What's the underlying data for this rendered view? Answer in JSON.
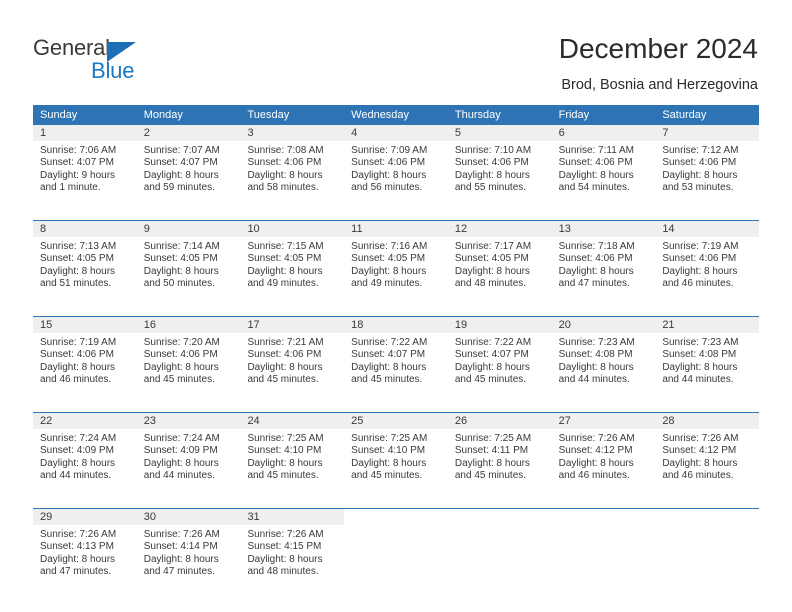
{
  "brand": {
    "word_one": "General",
    "word_two": "Blue",
    "triangle_icon": "triangle-icon",
    "accent_color": "#1a7ac4"
  },
  "header": {
    "title": "December 2024",
    "subtitle": "Brod, Bosnia and Herzegovina"
  },
  "calendar": {
    "header_color": "#2e74b5",
    "date_band_color": "#efefef",
    "weekday_labels": [
      "Sunday",
      "Monday",
      "Tuesday",
      "Wednesday",
      "Thursday",
      "Friday",
      "Saturday"
    ],
    "labels": {
      "sunrise": "Sunrise:",
      "sunset": "Sunset:",
      "daylight": "Daylight:"
    },
    "weeks": [
      [
        {
          "day": "1",
          "sunrise": "Sunrise: 7:06 AM",
          "sunset": "Sunset: 4:07 PM",
          "daylight_1": "Daylight: 9 hours",
          "daylight_2": "and 1 minute."
        },
        {
          "day": "2",
          "sunrise": "Sunrise: 7:07 AM",
          "sunset": "Sunset: 4:07 PM",
          "daylight_1": "Daylight: 8 hours",
          "daylight_2": "and 59 minutes."
        },
        {
          "day": "3",
          "sunrise": "Sunrise: 7:08 AM",
          "sunset": "Sunset: 4:06 PM",
          "daylight_1": "Daylight: 8 hours",
          "daylight_2": "and 58 minutes."
        },
        {
          "day": "4",
          "sunrise": "Sunrise: 7:09 AM",
          "sunset": "Sunset: 4:06 PM",
          "daylight_1": "Daylight: 8 hours",
          "daylight_2": "and 56 minutes."
        },
        {
          "day": "5",
          "sunrise": "Sunrise: 7:10 AM",
          "sunset": "Sunset: 4:06 PM",
          "daylight_1": "Daylight: 8 hours",
          "daylight_2": "and 55 minutes."
        },
        {
          "day": "6",
          "sunrise": "Sunrise: 7:11 AM",
          "sunset": "Sunset: 4:06 PM",
          "daylight_1": "Daylight: 8 hours",
          "daylight_2": "and 54 minutes."
        },
        {
          "day": "7",
          "sunrise": "Sunrise: 7:12 AM",
          "sunset": "Sunset: 4:06 PM",
          "daylight_1": "Daylight: 8 hours",
          "daylight_2": "and 53 minutes."
        }
      ],
      [
        {
          "day": "8",
          "sunrise": "Sunrise: 7:13 AM",
          "sunset": "Sunset: 4:05 PM",
          "daylight_1": "Daylight: 8 hours",
          "daylight_2": "and 51 minutes."
        },
        {
          "day": "9",
          "sunrise": "Sunrise: 7:14 AM",
          "sunset": "Sunset: 4:05 PM",
          "daylight_1": "Daylight: 8 hours",
          "daylight_2": "and 50 minutes."
        },
        {
          "day": "10",
          "sunrise": "Sunrise: 7:15 AM",
          "sunset": "Sunset: 4:05 PM",
          "daylight_1": "Daylight: 8 hours",
          "daylight_2": "and 49 minutes."
        },
        {
          "day": "11",
          "sunrise": "Sunrise: 7:16 AM",
          "sunset": "Sunset: 4:05 PM",
          "daylight_1": "Daylight: 8 hours",
          "daylight_2": "and 49 minutes."
        },
        {
          "day": "12",
          "sunrise": "Sunrise: 7:17 AM",
          "sunset": "Sunset: 4:05 PM",
          "daylight_1": "Daylight: 8 hours",
          "daylight_2": "and 48 minutes."
        },
        {
          "day": "13",
          "sunrise": "Sunrise: 7:18 AM",
          "sunset": "Sunset: 4:06 PM",
          "daylight_1": "Daylight: 8 hours",
          "daylight_2": "and 47 minutes."
        },
        {
          "day": "14",
          "sunrise": "Sunrise: 7:19 AM",
          "sunset": "Sunset: 4:06 PM",
          "daylight_1": "Daylight: 8 hours",
          "daylight_2": "and 46 minutes."
        }
      ],
      [
        {
          "day": "15",
          "sunrise": "Sunrise: 7:19 AM",
          "sunset": "Sunset: 4:06 PM",
          "daylight_1": "Daylight: 8 hours",
          "daylight_2": "and 46 minutes."
        },
        {
          "day": "16",
          "sunrise": "Sunrise: 7:20 AM",
          "sunset": "Sunset: 4:06 PM",
          "daylight_1": "Daylight: 8 hours",
          "daylight_2": "and 45 minutes."
        },
        {
          "day": "17",
          "sunrise": "Sunrise: 7:21 AM",
          "sunset": "Sunset: 4:06 PM",
          "daylight_1": "Daylight: 8 hours",
          "daylight_2": "and 45 minutes."
        },
        {
          "day": "18",
          "sunrise": "Sunrise: 7:22 AM",
          "sunset": "Sunset: 4:07 PM",
          "daylight_1": "Daylight: 8 hours",
          "daylight_2": "and 45 minutes."
        },
        {
          "day": "19",
          "sunrise": "Sunrise: 7:22 AM",
          "sunset": "Sunset: 4:07 PM",
          "daylight_1": "Daylight: 8 hours",
          "daylight_2": "and 45 minutes."
        },
        {
          "day": "20",
          "sunrise": "Sunrise: 7:23 AM",
          "sunset": "Sunset: 4:08 PM",
          "daylight_1": "Daylight: 8 hours",
          "daylight_2": "and 44 minutes."
        },
        {
          "day": "21",
          "sunrise": "Sunrise: 7:23 AM",
          "sunset": "Sunset: 4:08 PM",
          "daylight_1": "Daylight: 8 hours",
          "daylight_2": "and 44 minutes."
        }
      ],
      [
        {
          "day": "22",
          "sunrise": "Sunrise: 7:24 AM",
          "sunset": "Sunset: 4:09 PM",
          "daylight_1": "Daylight: 8 hours",
          "daylight_2": "and 44 minutes."
        },
        {
          "day": "23",
          "sunrise": "Sunrise: 7:24 AM",
          "sunset": "Sunset: 4:09 PM",
          "daylight_1": "Daylight: 8 hours",
          "daylight_2": "and 44 minutes."
        },
        {
          "day": "24",
          "sunrise": "Sunrise: 7:25 AM",
          "sunset": "Sunset: 4:10 PM",
          "daylight_1": "Daylight: 8 hours",
          "daylight_2": "and 45 minutes."
        },
        {
          "day": "25",
          "sunrise": "Sunrise: 7:25 AM",
          "sunset": "Sunset: 4:10 PM",
          "daylight_1": "Daylight: 8 hours",
          "daylight_2": "and 45 minutes."
        },
        {
          "day": "26",
          "sunrise": "Sunrise: 7:25 AM",
          "sunset": "Sunset: 4:11 PM",
          "daylight_1": "Daylight: 8 hours",
          "daylight_2": "and 45 minutes."
        },
        {
          "day": "27",
          "sunrise": "Sunrise: 7:26 AM",
          "sunset": "Sunset: 4:12 PM",
          "daylight_1": "Daylight: 8 hours",
          "daylight_2": "and 46 minutes."
        },
        {
          "day": "28",
          "sunrise": "Sunrise: 7:26 AM",
          "sunset": "Sunset: 4:12 PM",
          "daylight_1": "Daylight: 8 hours",
          "daylight_2": "and 46 minutes."
        }
      ],
      [
        {
          "day": "29",
          "sunrise": "Sunrise: 7:26 AM",
          "sunset": "Sunset: 4:13 PM",
          "daylight_1": "Daylight: 8 hours",
          "daylight_2": "and 47 minutes."
        },
        {
          "day": "30",
          "sunrise": "Sunrise: 7:26 AM",
          "sunset": "Sunset: 4:14 PM",
          "daylight_1": "Daylight: 8 hours",
          "daylight_2": "and 47 minutes."
        },
        {
          "day": "31",
          "sunrise": "Sunrise: 7:26 AM",
          "sunset": "Sunset: 4:15 PM",
          "daylight_1": "Daylight: 8 hours",
          "daylight_2": "and 48 minutes."
        },
        {
          "day": "",
          "sunrise": "",
          "sunset": "",
          "daylight_1": "",
          "daylight_2": ""
        },
        {
          "day": "",
          "sunrise": "",
          "sunset": "",
          "daylight_1": "",
          "daylight_2": ""
        },
        {
          "day": "",
          "sunrise": "",
          "sunset": "",
          "daylight_1": "",
          "daylight_2": ""
        },
        {
          "day": "",
          "sunrise": "",
          "sunset": "",
          "daylight_1": "",
          "daylight_2": ""
        }
      ]
    ]
  }
}
